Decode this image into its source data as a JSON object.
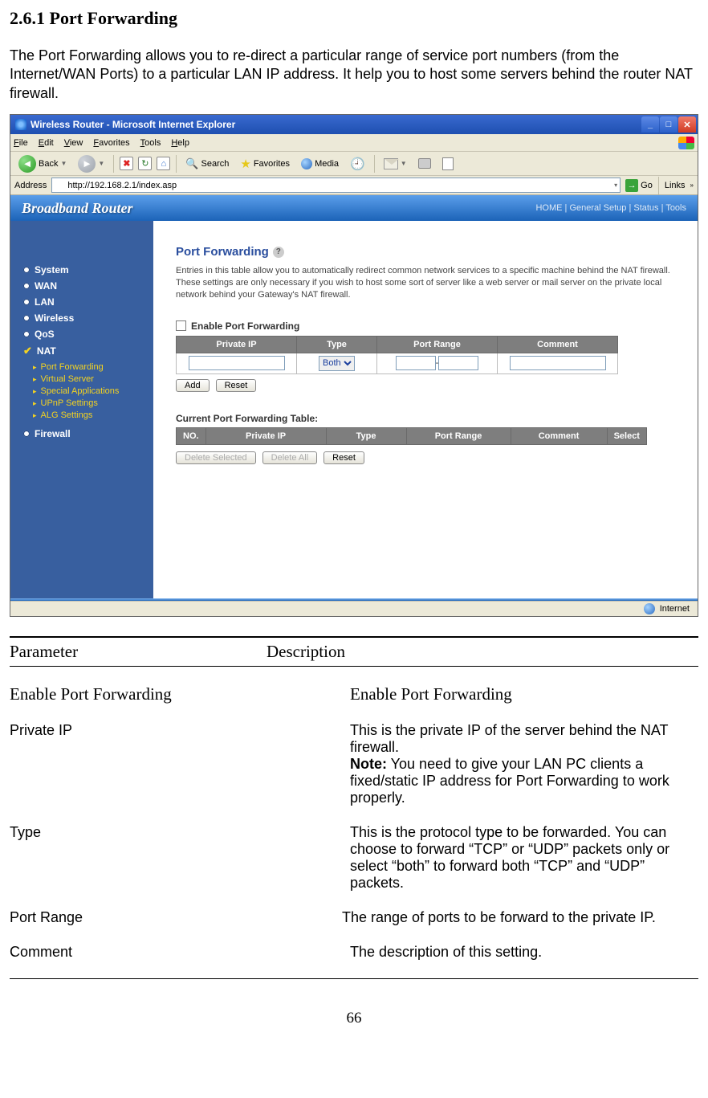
{
  "doc": {
    "heading": "2.6.1 Port Forwarding",
    "intro": "The Port Forwarding allows you to re-direct a particular range of service port numbers (from the Internet/WAN Ports) to a particular LAN IP address. It help you to host some servers behind the router NAT firewall.",
    "page_number": "66"
  },
  "ie": {
    "window_title": "Wireless Router - Microsoft Internet Explorer",
    "menu": {
      "file": "File",
      "edit": "Edit",
      "view": "View",
      "favorites": "Favorites",
      "tools": "Tools",
      "help": "Help"
    },
    "toolbar": {
      "back": "Back",
      "search": "Search",
      "favorites": "Favorites",
      "media": "Media"
    },
    "address_label": "Address",
    "url": "http://192.168.2.1/index.asp",
    "go": "Go",
    "links": "Links",
    "status_zone": "Internet"
  },
  "router": {
    "brand": "Broadband Router",
    "toplinks": "HOME | General Setup | Status | Tools",
    "sidebar": {
      "items": [
        "System",
        "WAN",
        "LAN",
        "Wireless",
        "QoS",
        "NAT",
        "Firewall"
      ],
      "nat_sub": [
        "Port Forwarding",
        "Virtual Server",
        "Special Applications",
        "UPnP Settings",
        "ALG Settings"
      ]
    },
    "page": {
      "title": "Port Forwarding",
      "desc": "Entries in this table allow you to automatically redirect common network services to a specific machine behind the NAT firewall. These settings are only necessary if you wish to host some sort of server like a web server or mail server on the private local network behind your Gateway's NAT firewall.",
      "enable_label": "Enable Port Forwarding",
      "headers": {
        "private_ip": "Private IP",
        "type": "Type",
        "port_range": "Port Range",
        "comment": "Comment",
        "no": "NO.",
        "select": "Select"
      },
      "type_value": "Both",
      "buttons": {
        "add": "Add",
        "reset": "Reset",
        "delete_selected": "Delete Selected",
        "delete_all": "Delete All"
      },
      "current_table_label": "Current Port Forwarding Table:"
    }
  },
  "param_table": {
    "header_col1": "Parameter",
    "header_col2": "Description",
    "rows": [
      {
        "p": "Enable Port Forwarding",
        "p_serif": true,
        "d": "Enable Port Forwarding",
        "d_serif": true
      },
      {
        "p": "Private IP",
        "d": "This is the private IP of the server behind the NAT firewall.",
        "note": "Note:",
        "note_rest": " You need to give your LAN PC clients a fixed/static IP address for Port Forwarding to work properly."
      },
      {
        "p": "Type",
        "d": "This is the protocol type to be forwarded. You can choose to forward “TCP” or “UDP” packets only or select “both” to forward both “TCP” and “UDP” packets."
      },
      {
        "p": "Port Range",
        "d": "The range of ports to be forward to the private IP.",
        "d_indent": "-10px"
      },
      {
        "p": "Comment",
        "d": "The description of this setting."
      }
    ]
  }
}
